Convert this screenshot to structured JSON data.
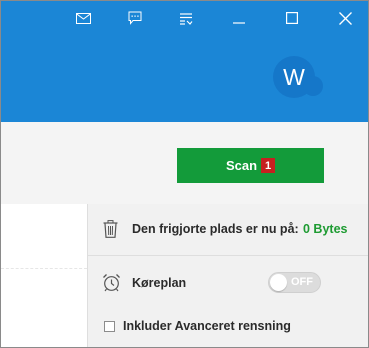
{
  "titlebar": {
    "controls": [
      {
        "name": "mail-icon"
      },
      {
        "name": "feedback-icon"
      },
      {
        "name": "menu-list-icon"
      },
      {
        "name": "minimize-icon"
      },
      {
        "name": "maximize-icon"
      },
      {
        "name": "close-icon"
      }
    ],
    "avatar_letter": "W"
  },
  "scan": {
    "label": "Scan",
    "badge_count": "1"
  },
  "freed_space": {
    "label": "Den frigjorte plads er nu på:",
    "value": "0 Bytes",
    "value_color": "#1e9b32"
  },
  "schedule": {
    "label": "Køreplan",
    "toggle_text": "OFF"
  },
  "advanced": {
    "label": "Inkluder Avanceret rensning"
  },
  "colors": {
    "header_blue": "#1b86d6",
    "scan_green": "#139b3a",
    "badge_red": "#c62020"
  }
}
